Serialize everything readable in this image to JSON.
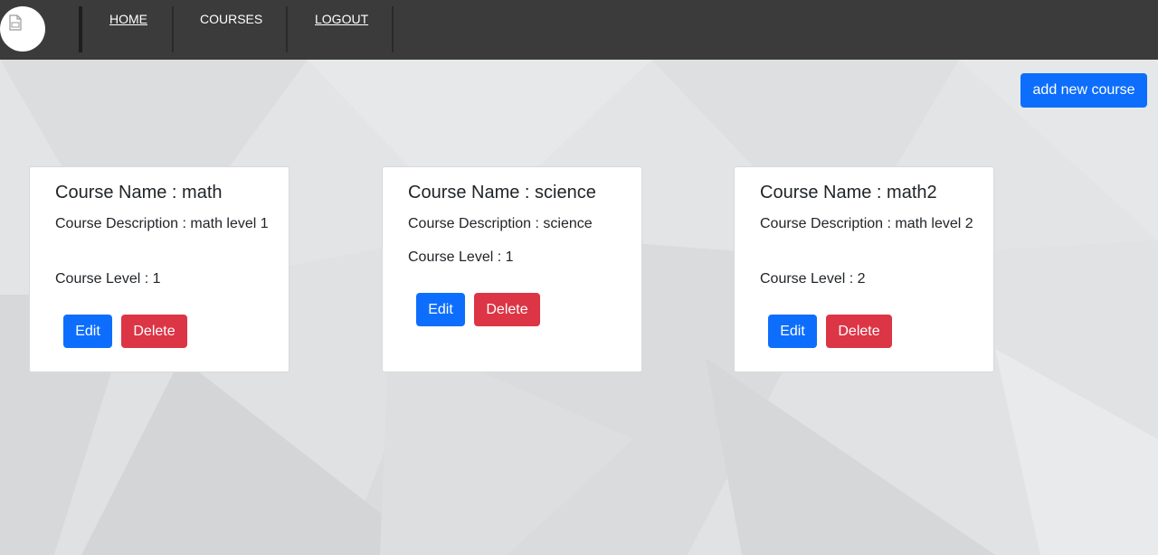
{
  "nav": {
    "home": "HOME",
    "courses": "COURSES",
    "logout": "LOGOUT"
  },
  "actions": {
    "add_course": "add new course"
  },
  "courses": [
    {
      "title": "Course Name : math",
      "description": "Course Description : math level 1",
      "level": "Course Level : 1",
      "edit": "Edit",
      "delete": "Delete"
    },
    {
      "title": "Course Name : science",
      "description": "Course Description : science",
      "level": "Course Level : 1",
      "edit": "Edit",
      "delete": "Delete"
    },
    {
      "title": "Course Name : math2",
      "description": "Course Description : math level 2",
      "level": "Course Level : 2",
      "edit": "Edit",
      "delete": "Delete"
    }
  ],
  "colors": {
    "navbar": "#3b3b3b",
    "primary": "#0d6efd",
    "danger": "#dc3545",
    "background": "#e3e4e5"
  }
}
